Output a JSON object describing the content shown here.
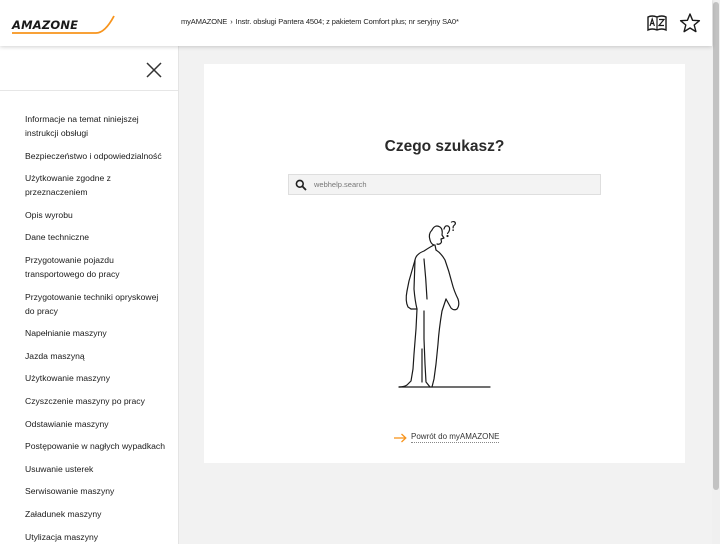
{
  "header": {
    "logo_text": "AMAZONE",
    "breadcrumb": {
      "root": "myAMAZONE",
      "separator": "›",
      "current": "Instr. obsługi Pantera 4504; z pakietem Comfort plus; nr seryjny SA0*"
    },
    "icons": [
      "language-icon",
      "star-icon"
    ],
    "accent_color": "#f7941d"
  },
  "sidebar": {
    "items": [
      {
        "label": "Informacje na temat niniejszej instrukcji obsługi"
      },
      {
        "label": "Bezpieczeństwo i odpowiedzialność"
      },
      {
        "label": "Użytkowanie zgodne z przeznaczeniem"
      },
      {
        "label": "Opis wyrobu"
      },
      {
        "label": "Dane techniczne"
      },
      {
        "label": "Przygotowanie pojazdu transportowego do pracy"
      },
      {
        "label": "Przygotowanie techniki opryskowej do pracy"
      },
      {
        "label": "Napełnianie maszyny"
      },
      {
        "label": "Jazda maszyną"
      },
      {
        "label": "Użytkowanie maszyny"
      },
      {
        "label": "Czyszczenie maszyny po pracy"
      },
      {
        "label": "Odstawianie maszyny"
      },
      {
        "label": "Postępowanie w nagłych wypadkach"
      },
      {
        "label": "Usuwanie usterek"
      },
      {
        "label": "Serwisowanie maszyny"
      },
      {
        "label": "Załadunek maszyny"
      },
      {
        "label": "Utylizacja maszyny"
      }
    ]
  },
  "main": {
    "title": "Czego szukasz?",
    "search": {
      "value": "",
      "placeholder": "webhelp.search"
    },
    "back_link": "Powrót do myAMAZONE"
  }
}
